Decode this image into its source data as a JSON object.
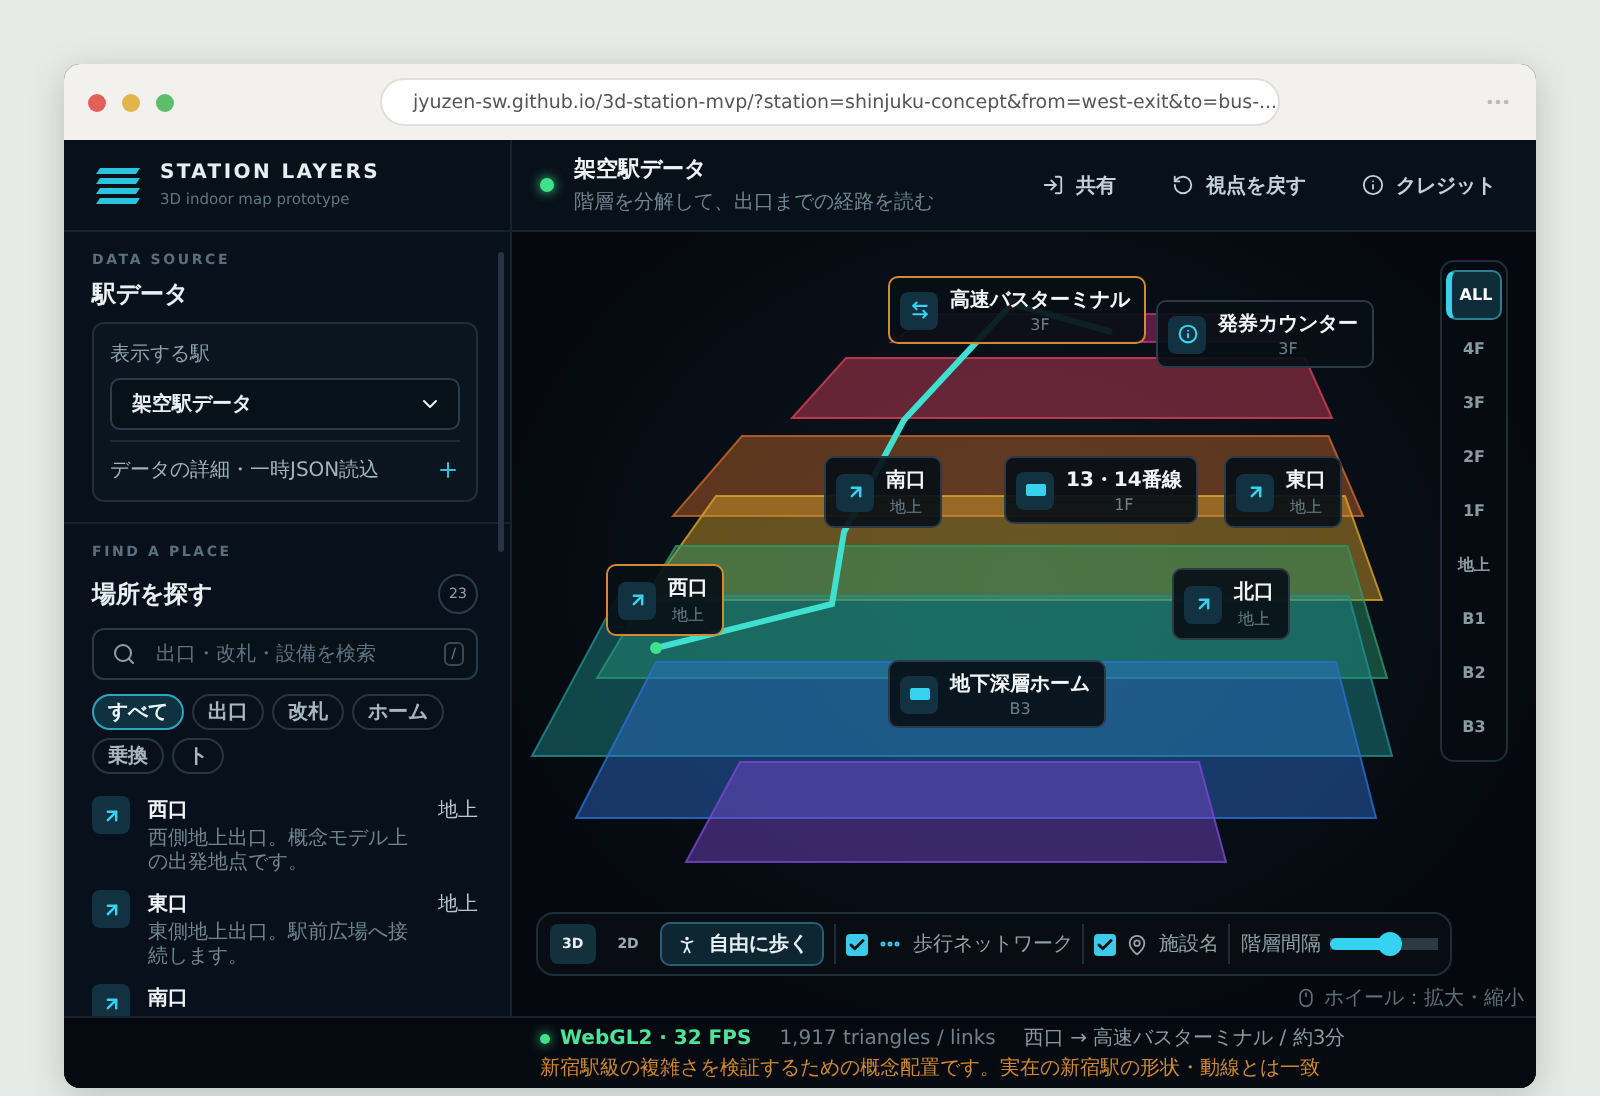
{
  "browser": {
    "url": "jyuzen-sw.github.io/3d-station-mvp/?station=shinjuku-concept&from=west-exit&to=bus-..."
  },
  "brand": {
    "title": "STATION LAYERS",
    "subtitle": "3D indoor map prototype"
  },
  "station_header": {
    "title": "架空駅データ",
    "subtitle": "階層を分解して、出口までの経路を読む"
  },
  "header_actions": [
    {
      "kind": "share",
      "label": "共有"
    },
    {
      "kind": "reset",
      "label": "視点を戻す"
    },
    {
      "kind": "info",
      "label": "クレジット"
    }
  ],
  "data_source": {
    "eyebrow": "DATA SOURCE",
    "title": "駅データ",
    "field_label": "表示する駅",
    "selected_station": "架空駅データ",
    "details_label": "データの詳細・一時JSON読込"
  },
  "find_place": {
    "eyebrow": "FIND A PLACE",
    "title": "場所を探す",
    "count": "23",
    "search": {
      "placeholder": "出口・改札・設備を検索",
      "shortcut": "/"
    },
    "filters": [
      {
        "label": "すべて",
        "selected": true
      },
      {
        "label": "出口",
        "selected": false
      },
      {
        "label": "改札",
        "selected": false
      },
      {
        "label": "ホーム",
        "selected": false
      },
      {
        "label": "乗換",
        "selected": false
      },
      {
        "label": "ト",
        "selected": false
      }
    ],
    "places": [
      {
        "kind": "exit",
        "name": "西口",
        "description": "西側地上出口。概念モデル上の出発地点です。",
        "floor": "地上"
      },
      {
        "kind": "exit",
        "name": "東口",
        "description": "東側地上出口。駅前広場へ接続します。",
        "floor": "地上"
      },
      {
        "kind": "exit",
        "name": "南口"
      }
    ]
  },
  "map": {
    "labels": [
      {
        "kind": "transfer",
        "name": "高速バスターミナル",
        "floor": "3F",
        "highlighted": true
      },
      {
        "kind": "info",
        "name": "発券カウンター",
        "floor": "3F",
        "highlighted": false
      },
      {
        "kind": "exit",
        "name": "南口",
        "floor": "地上",
        "highlighted": false
      },
      {
        "kind": "platform",
        "name": "13・14番線",
        "floor": "1F",
        "highlighted": false
      },
      {
        "kind": "exit",
        "name": "東口",
        "floor": "地上",
        "highlighted": false
      },
      {
        "kind": "exit",
        "name": "西口",
        "floor": "地上",
        "highlighted": true
      },
      {
        "kind": "exit",
        "name": "北口",
        "floor": "地上",
        "highlighted": false
      },
      {
        "kind": "platform",
        "name": "地下深層ホーム",
        "floor": "B3",
        "highlighted": false
      }
    ],
    "floors": [
      {
        "label": "ALL",
        "selected": true
      },
      {
        "label": "4F",
        "selected": false
      },
      {
        "label": "3F",
        "selected": false
      },
      {
        "label": "2F",
        "selected": false
      },
      {
        "label": "1F",
        "selected": false
      },
      {
        "label": "地上",
        "selected": false
      },
      {
        "label": "B1",
        "selected": false
      },
      {
        "label": "B2",
        "selected": false
      },
      {
        "label": "B3",
        "selected": false
      }
    ],
    "controls": {
      "views": [
        {
          "label": "3D",
          "selected": true
        },
        {
          "label": "2D",
          "selected": false
        }
      ],
      "walk_button": "自由に歩く",
      "toggles": [
        {
          "kind": "network",
          "label": "歩行ネットワーク",
          "checked": true
        },
        {
          "kind": "names",
          "label": "施設名",
          "checked": true
        }
      ],
      "spacing": {
        "label": "階層間隔",
        "level": 0.55
      }
    },
    "hint": "ホイール：拡大・縮小"
  },
  "status_bar": {
    "renderer": "WebGL2 · 32 FPS",
    "stats": "1,917 triangles / links",
    "route": "西口 → 高速バスターミナル / 約3分",
    "notice": "新宿駅級の複雑さを検証するための概念配置です。実在の新宿駅の形状・動線とは一致"
  }
}
